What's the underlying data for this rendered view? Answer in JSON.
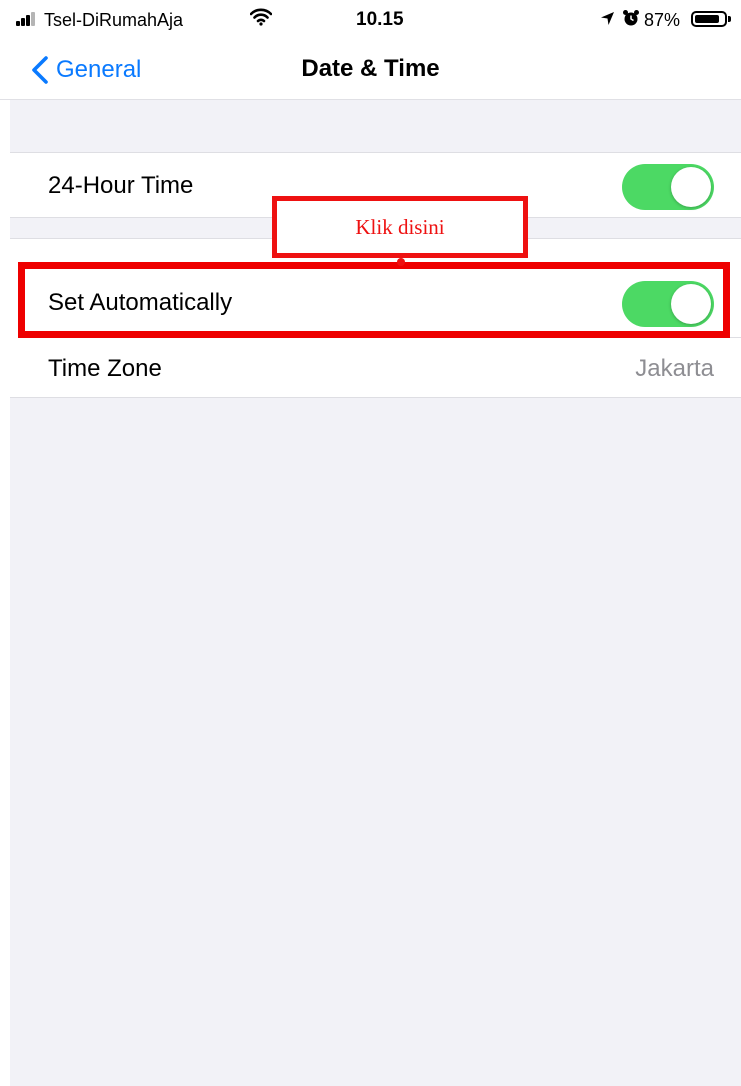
{
  "status_bar": {
    "carrier": "Tsel-DiRumahAja",
    "time": "10.15",
    "battery_percent": "87%",
    "battery_level": 0.87,
    "icons": [
      "signal-icon",
      "wifi-icon",
      "location-icon",
      "alarm-icon",
      "battery-icon"
    ]
  },
  "nav": {
    "back_label": "General",
    "title": "Date & Time"
  },
  "settings": {
    "hour_24": {
      "label": "24-Hour Time",
      "on": true
    },
    "set_automatically": {
      "label": "Set Automatically",
      "on": true
    },
    "time_zone": {
      "label": "Time Zone",
      "value": "Jakarta"
    }
  },
  "annotation": {
    "callout_text": "Klik disini"
  },
  "colors": {
    "toggle_on": "#4cd964",
    "accent": "#0a7aff",
    "annotation": "#ee1111",
    "background": "#f2f2f7"
  }
}
